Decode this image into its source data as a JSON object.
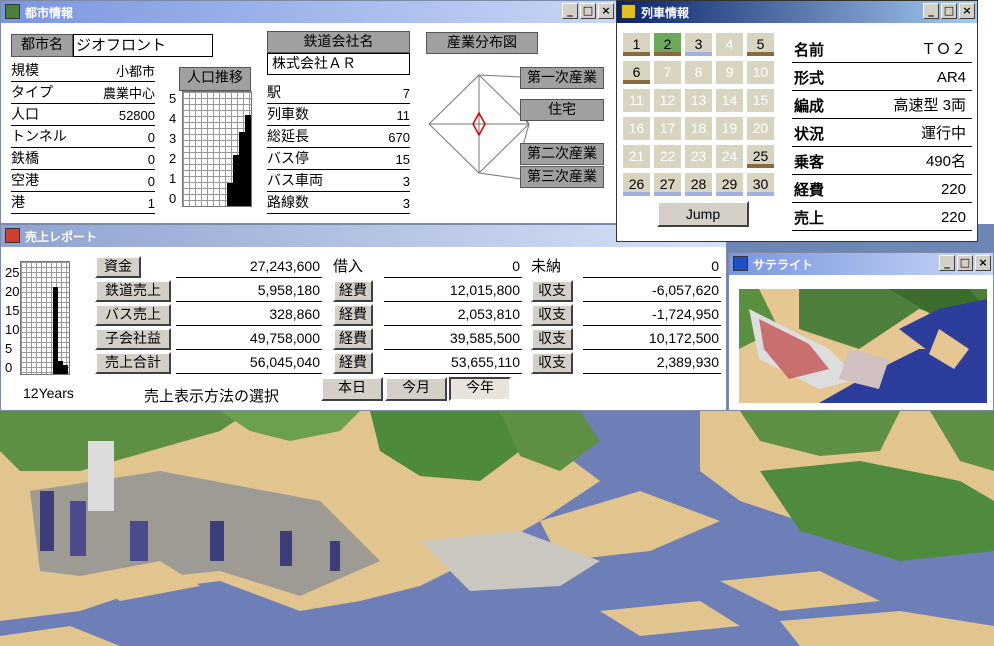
{
  "city": {
    "title": "都市情報",
    "name_label": "都市名",
    "name_value": "ジオフロント",
    "rows": [
      {
        "k": "規模",
        "v": "小都市"
      },
      {
        "k": "タイプ",
        "v": "農業中心"
      },
      {
        "k": "人口",
        "v": "52800"
      },
      {
        "k": "トンネル",
        "v": "0"
      },
      {
        "k": "鉄橋",
        "v": "0"
      },
      {
        "k": "空港",
        "v": "0"
      },
      {
        "k": "港",
        "v": "1"
      }
    ],
    "pop_title": "人口推移",
    "pop_axis": [
      "5",
      "4",
      "3",
      "2",
      "1",
      "0"
    ],
    "company_label": "鉄道会社名",
    "company_value": "株式会社ＡＲ",
    "stats": [
      {
        "k": "駅",
        "v": "7"
      },
      {
        "k": "列車数",
        "v": "11"
      },
      {
        "k": "総延長",
        "v": "670"
      },
      {
        "k": "バス停",
        "v": "15"
      },
      {
        "k": "バス車両",
        "v": "3"
      },
      {
        "k": "路線数",
        "v": "3"
      }
    ],
    "industry_title": "産業分布図",
    "industry_labels": [
      "第一次産業",
      "住宅",
      "第二次産業",
      "第三次産業"
    ]
  },
  "train": {
    "title": "列車情報",
    "cells": [
      "1",
      "2",
      "3",
      "4",
      "5",
      "6",
      "7",
      "8",
      "9",
      "10",
      "11",
      "12",
      "13",
      "14",
      "15",
      "16",
      "17",
      "18",
      "19",
      "20",
      "21",
      "22",
      "23",
      "24",
      "25",
      "26",
      "27",
      "28",
      "29",
      "30"
    ],
    "jump": "Jump",
    "rows": [
      {
        "k": "名前",
        "v": "ＴＯ２"
      },
      {
        "k": "形式",
        "v": "AR4"
      },
      {
        "k": "編成",
        "v": "高速型 3両"
      },
      {
        "k": "状況",
        "v": "運行中"
      },
      {
        "k": "乗客",
        "v": "490名"
      },
      {
        "k": "経費",
        "v": "220"
      },
      {
        "k": "売上",
        "v": "220"
      }
    ],
    "clip": "Ju"
  },
  "sales": {
    "title": "売上レポート",
    "axis": [
      "25",
      "20",
      "15",
      "10",
      "5",
      "0"
    ],
    "years": "12Years",
    "labels": [
      "資金",
      "鉄道売上",
      "バス売上",
      "子会社益",
      "売上合計"
    ],
    "col1": [
      "27,243,600",
      "5,958,180",
      "328,860",
      "49,758,000",
      "56,045,040"
    ],
    "mid_labels": [
      "借入",
      "経費",
      "経費",
      "経費",
      "経費"
    ],
    "col2": [
      "0",
      "12,015,800",
      "2,053,810",
      "39,585,500",
      "53,655,110"
    ],
    "right_labels": [
      "未納",
      "収支",
      "収支",
      "収支",
      "収支"
    ],
    "col3": [
      "0",
      "-6,057,620",
      "-1,724,950",
      "10,172,500",
      "2,389,930"
    ],
    "method": "売上表示方法の選択",
    "periods": [
      "本日",
      "今月",
      "今年"
    ]
  },
  "satellite": {
    "title": "サテライト"
  },
  "colors": {
    "grass": "#5e9a4a",
    "sand": "#e8cc98",
    "water": "#5a68b0",
    "accent": "#0a246a"
  }
}
